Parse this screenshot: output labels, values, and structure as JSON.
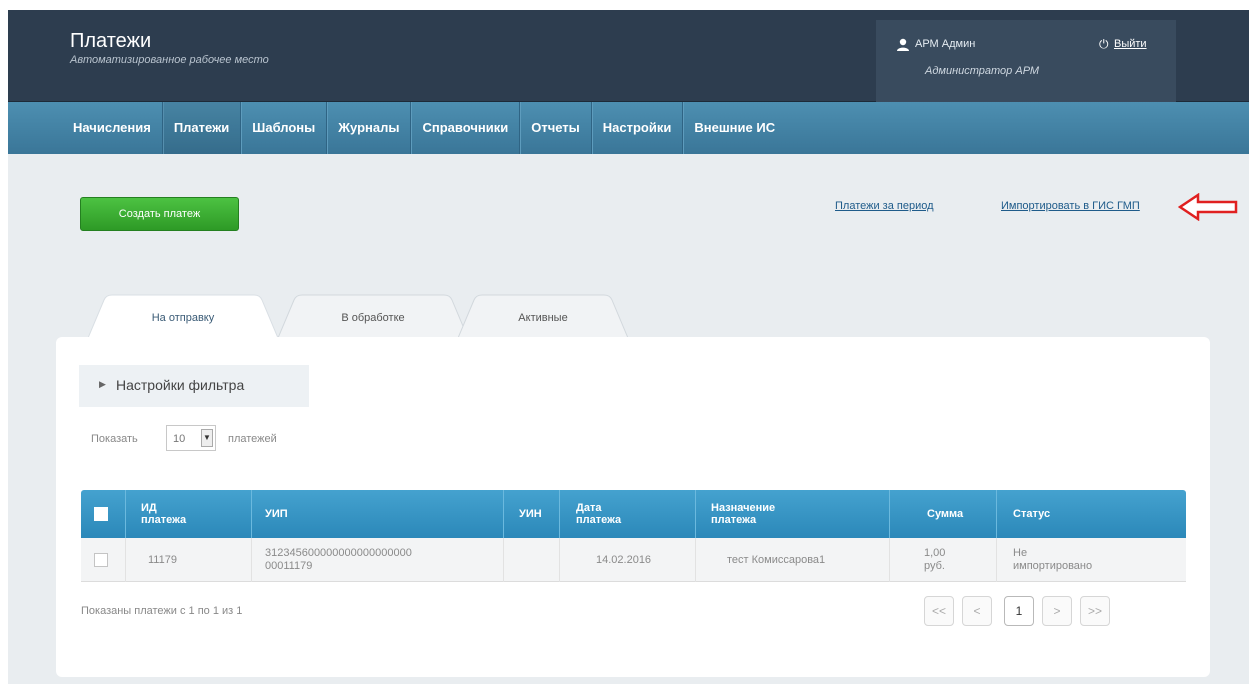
{
  "header": {
    "title": "Платежи",
    "subtitle": "Автоматизированное рабочее место",
    "user_name": "АРМ Админ",
    "user_role": "Администратор АРМ",
    "logout_label": "Выйти"
  },
  "nav": {
    "items": [
      {
        "label": "Начисления"
      },
      {
        "label": "Платежи"
      },
      {
        "label": "Шаблоны"
      },
      {
        "label": "Журналы"
      },
      {
        "label": "Справочники"
      },
      {
        "label": "Отчеты"
      },
      {
        "label": "Настройки"
      },
      {
        "label": "Внешние ИС"
      }
    ],
    "active": "Платежи"
  },
  "actions": {
    "create_label": "Создать платеж",
    "period_link": "Платежи за период",
    "import_link": "Импортировать в ГИС ГМП"
  },
  "tabs": [
    {
      "label": "На отправку",
      "active": true
    },
    {
      "label": "В обработке",
      "active": false
    },
    {
      "label": "Активные",
      "active": false
    }
  ],
  "filter": {
    "label": "Настройки фильтра"
  },
  "pagesize": {
    "prefix": "Показать",
    "value": "10",
    "suffix": "платежей"
  },
  "table": {
    "columns": [
      {
        "label": "ИД\nплатежа"
      },
      {
        "label": "УИП"
      },
      {
        "label": "УИН"
      },
      {
        "label": "Дата\nплатежа"
      },
      {
        "label": "Назначение\nплатежа"
      },
      {
        "label": "Сумма"
      },
      {
        "label": "Статус"
      }
    ],
    "rows": [
      {
        "id": "11179",
        "uip": "312345600000000000000000\n00011179",
        "uin": "",
        "date": "14.02.2016",
        "purpose": "тест Комиссарова1",
        "sum": "1,00\nруб.",
        "status": "Не\nимпортировано"
      }
    ]
  },
  "footer": {
    "info": "Показаны платежи с 1 по 1 из 1"
  },
  "pager": {
    "first": "<<",
    "prev": "<",
    "current": "1",
    "next": ">",
    "last": ">>"
  },
  "colors": {
    "header_bg": "#2d3d4f",
    "nav_bg": "#3a7698",
    "button_green": "#3aaa30",
    "table_head": "#3596c6",
    "annotation_arrow": "#e02020"
  },
  "icons": [
    "user-icon",
    "power-icon",
    "chevron-right-icon",
    "dropdown-arrow-icon",
    "checkbox-icon",
    "red-arrow-annotation"
  ]
}
